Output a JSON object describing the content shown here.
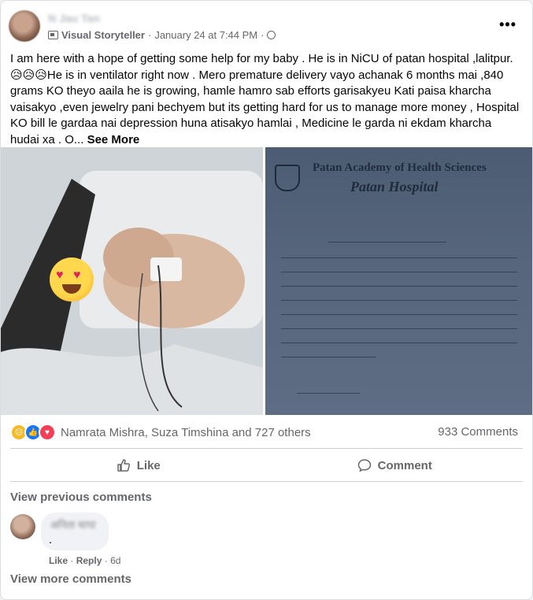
{
  "post": {
    "author_name": "N Jau Tan",
    "page_label": "Visual Storyteller",
    "date": "January 24 at 7:44 PM",
    "separator": "·",
    "more_label": "•••",
    "text": "I am here with a hope of getting some help for my baby . He is in NiCU of patan hospital ,lalitpur. 😥😥😥He is in ventilator right now . Mero premature delivery vayo achanak 6 months mai ,840 grams KO theyo  aaila he is growing, hamle hamro sab efforts garisakyeu Kati paisa kharcha vaisakyo ,even jewelry pani bechyem but its getting hard for us to manage more money , Hospital KO bill le gardaa nai depression huna atisakyo hamlai , Medicine le garda ni ekdam kharcha hudai xa . O...",
    "see_more": "See More"
  },
  "photos": {
    "letter_title": "Patan Academy of Health Sciences",
    "letter_subtitle": "Patan Hospital"
  },
  "reactions": {
    "names": "Namrata Mishra, Suza Timshina and 727 others",
    "comments_count": "933 Comments",
    "icons": [
      "sad",
      "like",
      "love"
    ]
  },
  "actions": {
    "like": "Like",
    "comment": "Comment"
  },
  "comments": {
    "view_previous": "View previous comments",
    "items": [
      {
        "author": "अनिता थापा",
        "text": ".",
        "like": "Like",
        "reply": "Reply",
        "time": "6d"
      }
    ],
    "view_more": "View more comments"
  }
}
